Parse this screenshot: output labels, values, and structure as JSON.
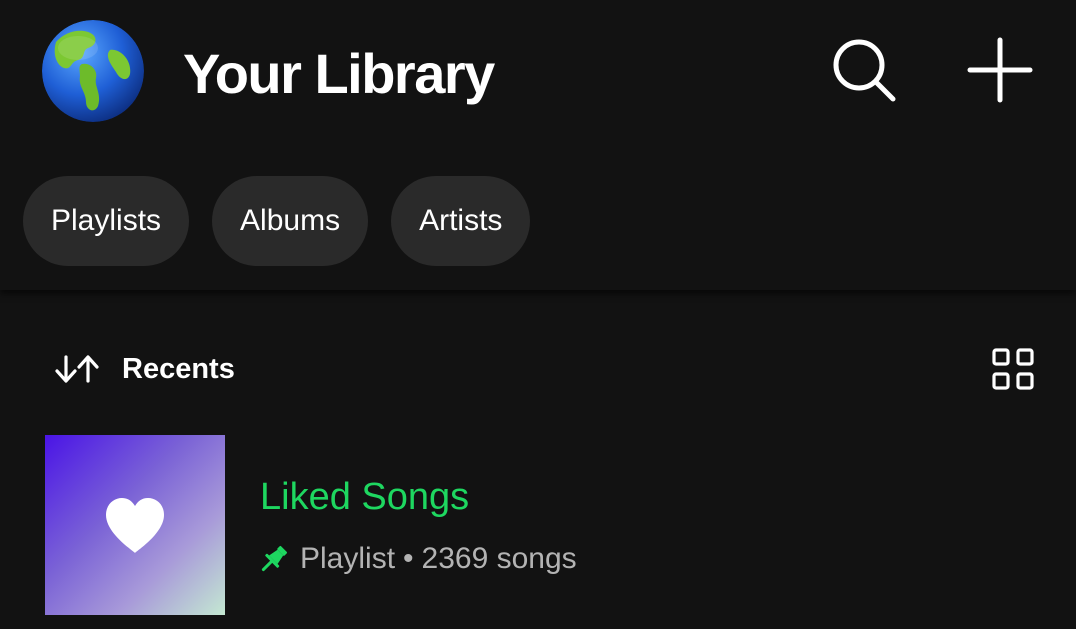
{
  "header": {
    "title": "Your Library",
    "avatar_icon": "globe-avatar-icon",
    "search_icon": "search-icon",
    "add_icon": "plus-icon"
  },
  "filters": [
    {
      "label": "Playlists"
    },
    {
      "label": "Albums"
    },
    {
      "label": "Artists"
    }
  ],
  "sort": {
    "label": "Recents",
    "icon": "sort-arrows-icon"
  },
  "view_toggle_icon": "grid-view-icon",
  "items": [
    {
      "title": "Liked Songs",
      "type": "Playlist",
      "separator": "•",
      "count": "2369 songs",
      "pinned": true,
      "cover_icon": "heart-icon",
      "pin_icon": "pin-icon"
    }
  ],
  "colors": {
    "background": "#121212",
    "chip": "#2a2a2a",
    "accent": "#1ed760",
    "secondary_text": "#b3b3b3"
  }
}
